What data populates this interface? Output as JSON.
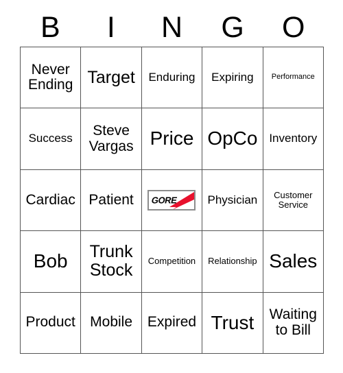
{
  "card": {
    "title": "BINGO",
    "header_letters": [
      "B",
      "I",
      "N",
      "G",
      "O"
    ],
    "grid_size": "5x5",
    "colors": {
      "grid_line": "#555555",
      "cell_background": "#ffffff",
      "text": "#000000",
      "logo_red": "#e8112d",
      "logo_border": "#8c8c8c"
    },
    "free_space": {
      "position": "row3-col3",
      "type": "logo",
      "logo_text": "GORE",
      "logo_name": "gore-logo"
    },
    "rows": [
      [
        {
          "text": "Never Ending",
          "size": "sz-md"
        },
        {
          "text": "Target",
          "size": "sz-lg"
        },
        {
          "text": "Enduring",
          "size": "sz-sm"
        },
        {
          "text": "Expiring",
          "size": "sz-sm"
        },
        {
          "text": "Performance",
          "size": "sz-xxs"
        }
      ],
      [
        {
          "text": "Success",
          "size": "sz-sm"
        },
        {
          "text": "Steve Vargas",
          "size": "sz-md"
        },
        {
          "text": "Price",
          "size": "sz-xl"
        },
        {
          "text": "OpCo",
          "size": "sz-xl"
        },
        {
          "text": "Inventory",
          "size": "sz-sm"
        }
      ],
      [
        {
          "text": "Cardiac",
          "size": "sz-md"
        },
        {
          "text": "Patient",
          "size": "sz-md"
        },
        {
          "text": "GORE",
          "size": "logo"
        },
        {
          "text": "Physician",
          "size": "sz-sm"
        },
        {
          "text": "Customer Service",
          "size": "sz-xs"
        }
      ],
      [
        {
          "text": "Bob",
          "size": "sz-xl"
        },
        {
          "text": "Trunk Stock",
          "size": "sz-lg"
        },
        {
          "text": "Competition",
          "size": "sz-xs"
        },
        {
          "text": "Relationship",
          "size": "sz-xs"
        },
        {
          "text": "Sales",
          "size": "sz-xl"
        }
      ],
      [
        {
          "text": "Product",
          "size": "sz-md"
        },
        {
          "text": "Mobile",
          "size": "sz-md"
        },
        {
          "text": "Expired",
          "size": "sz-md"
        },
        {
          "text": "Trust",
          "size": "sz-xl"
        },
        {
          "text": "Waiting to Bill",
          "size": "sz-md"
        }
      ]
    ]
  }
}
